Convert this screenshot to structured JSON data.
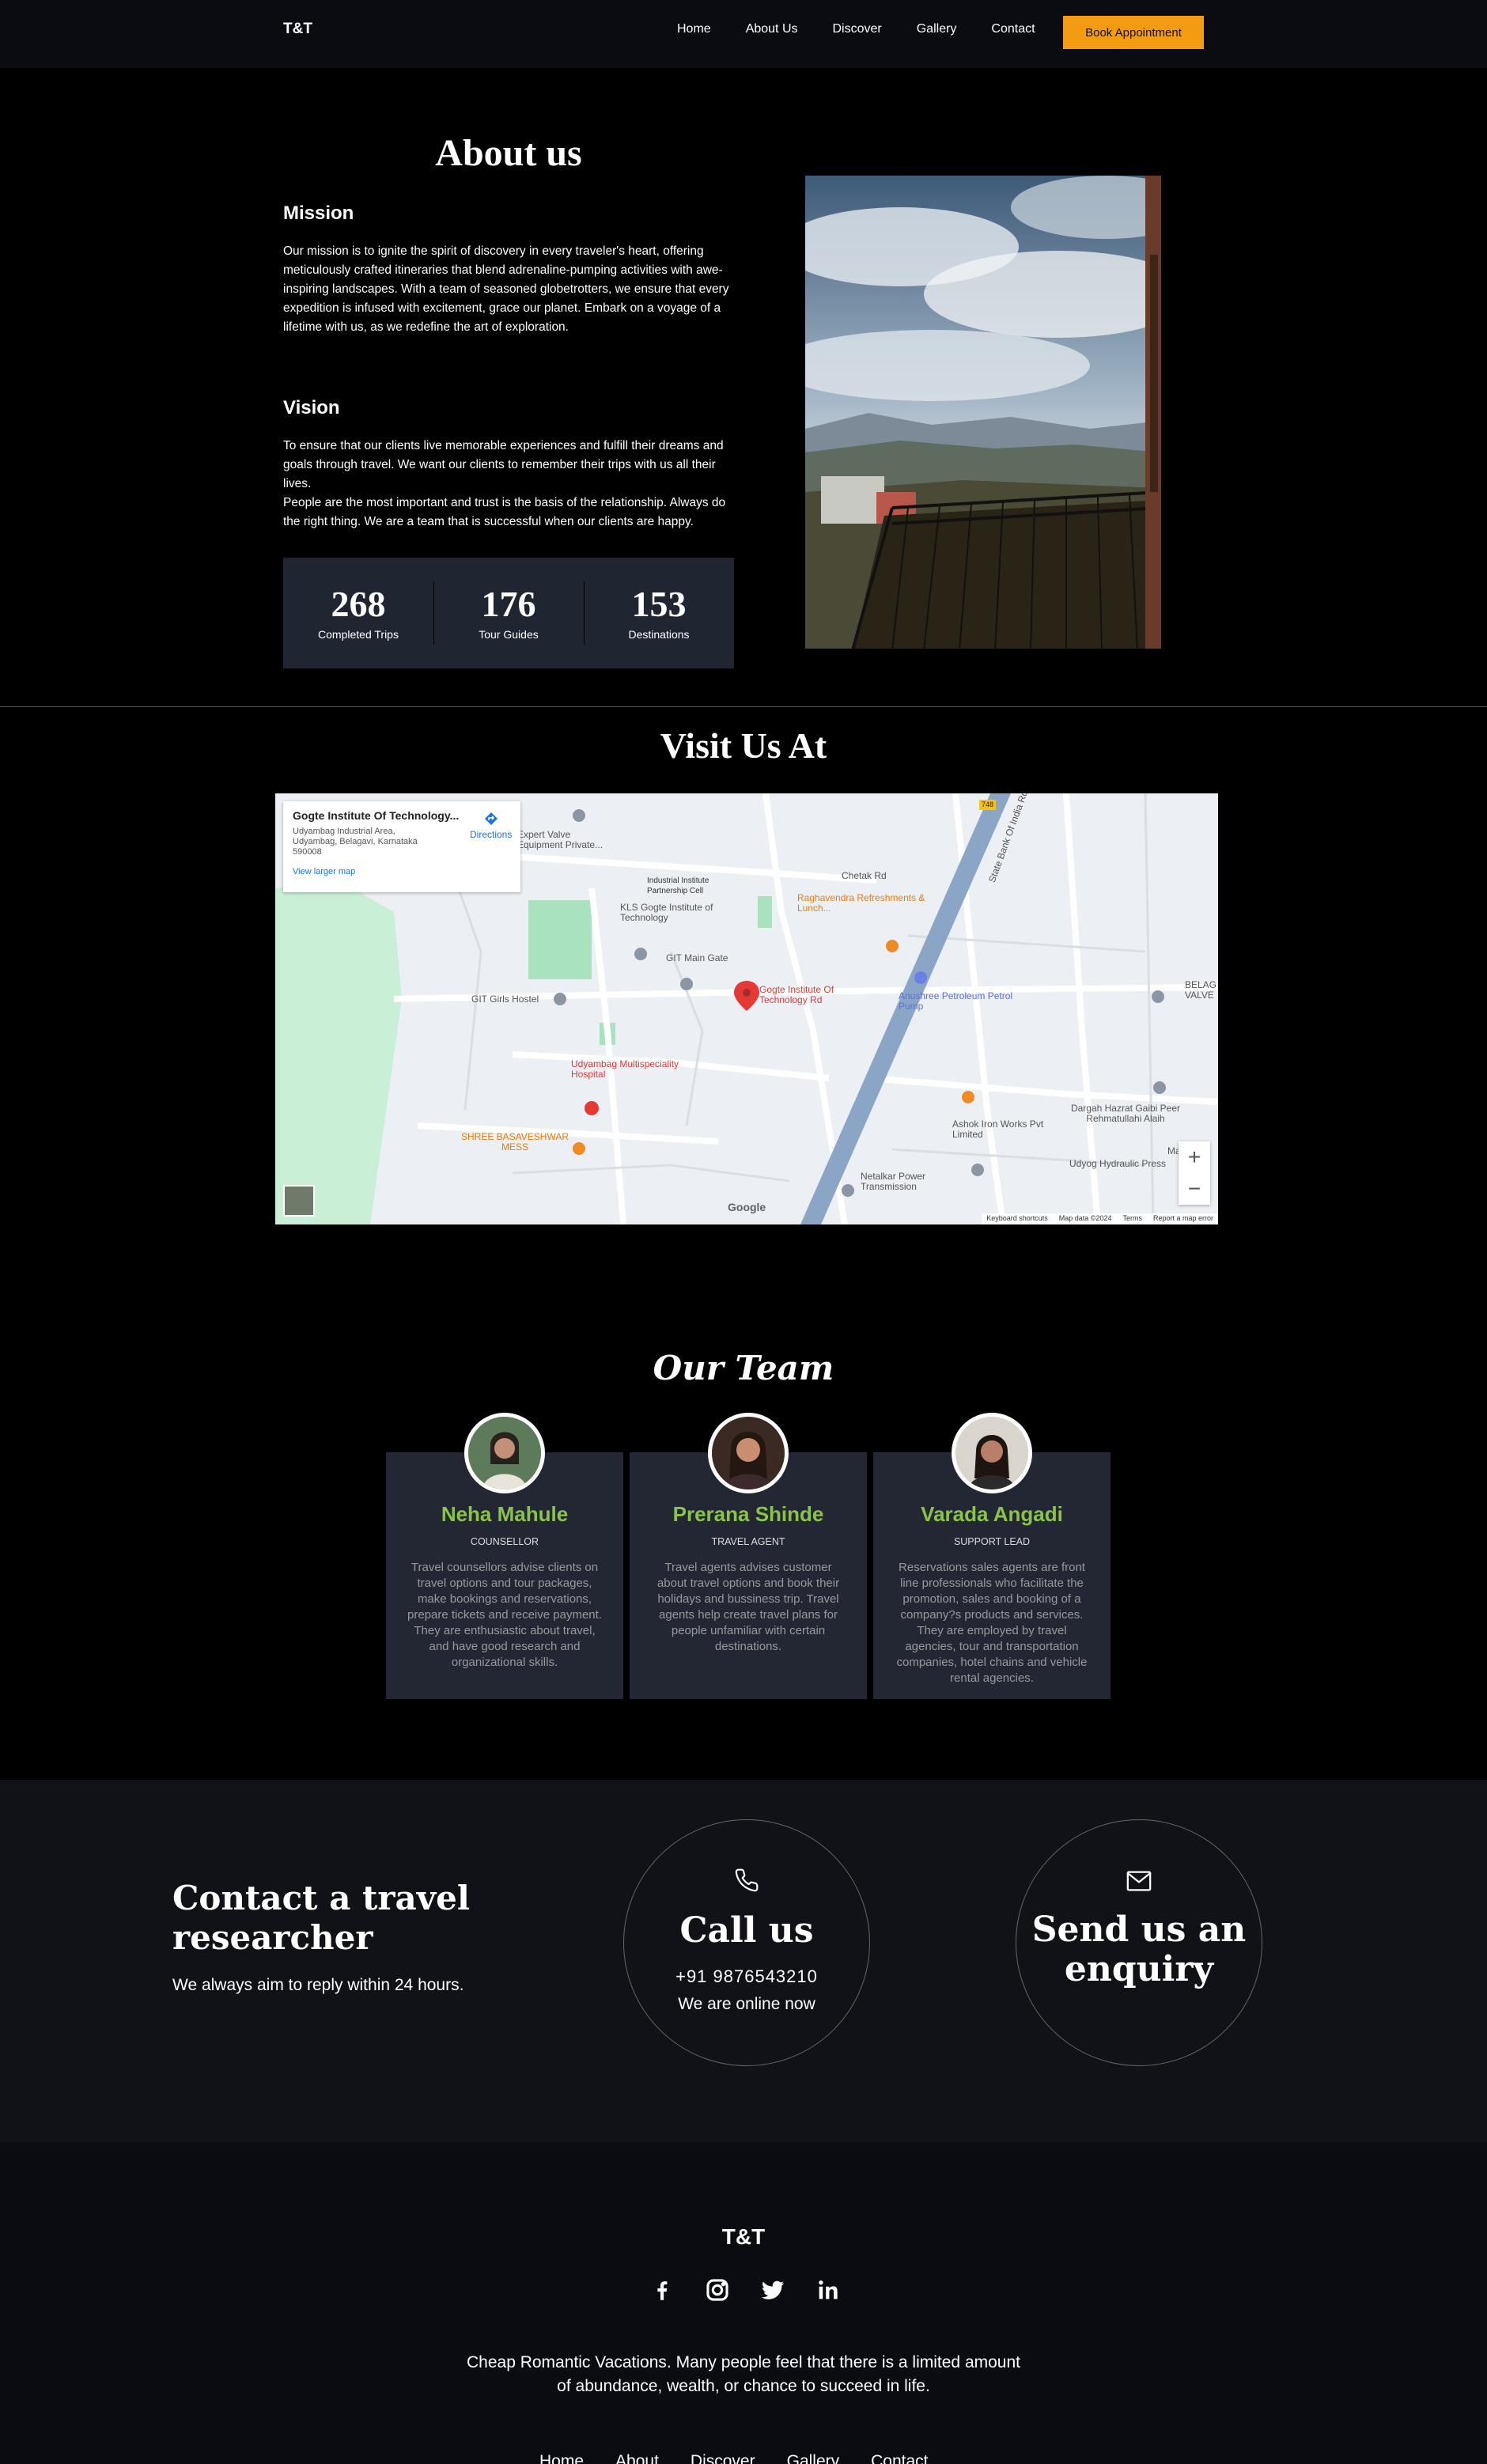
{
  "nav": {
    "brand": "T&T",
    "links": [
      "Home",
      "About Us",
      "Discover",
      "Gallery",
      "Contact"
    ],
    "cta": "Book Appointment",
    "accent": "#f39c12"
  },
  "about": {
    "title": "About us",
    "mission_heading": "Mission",
    "mission_text": "Our mission is to ignite the spirit of discovery in every traveler's heart, offering meticulously crafted itineraries that blend adrenaline-pumping activities with awe-inspiring landscapes. With a team of seasoned globetrotters, we ensure that every expedition is infused with excitement, grace our planet. Embark on a voyage of a lifetime with us, as we redefine the art of exploration.",
    "vision_heading": "Vision",
    "vision_text_1": "To ensure that our clients live memorable experiences and fulfill their dreams and goals through travel. We want our clients to remember their trips with us all their lives.",
    "vision_text_2": "People are the most important and trust is the basis of the relationship. Always do the right thing. We are a team that is successful when our clients are happy.",
    "stats": [
      {
        "value": "268",
        "label": "Completed Trips"
      },
      {
        "value": "176",
        "label": "Tour Guides"
      },
      {
        "value": "153",
        "label": "Destinations"
      }
    ]
  },
  "visit": {
    "title": "Visit Us At",
    "map": {
      "place_name": "Gogte Institute Of Technology...",
      "address": "Udyambag Industrial Area, Udyambag, Belagavi, Karnataka 590008",
      "directions": "Directions",
      "larger_map": "View larger map",
      "pin_label": "Gogte Institute Of Technology Rd",
      "labels": {
        "expert": "Expert Valve Equipment Private...",
        "industrial": "Industrial Institute Partnership Cell",
        "kls": "KLS Gogte Institute of Technology",
        "chetak": "Chetak Rd",
        "raghavendra": "Raghavendra Refreshments & Lunch...",
        "gitgate": "GIT Main Gate",
        "girls": "GIT Girls Hostel",
        "anushree": "Anushree Petroleum Petrol Pump",
        "hospital": "Udyambag Multispeciality Hospital",
        "shree": "SHREE BASAVESHWAR MESS",
        "dargah": "Dargah Hazrat Gaibi Peer Rehmatullahi Alaih",
        "ashok": "Ashok Iron Works Pvt Limited",
        "udyog": "Udyog Hydraulic Press",
        "netalkar": "Netalkar Power Transmission",
        "state": "State Bank Of India Rd",
        "belag": "BELAG VALVE",
        "maaruti": "Maaruti",
        "road_num": "748"
      },
      "google": "Google",
      "footer": [
        "Keyboard shortcuts",
        "Map data ©2024",
        "Terms",
        "Report a map error"
      ],
      "zoom_in": "+",
      "zoom_out": "−"
    }
  },
  "team": {
    "title": "Our Team",
    "members": [
      {
        "name": "Neha Mahule",
        "role": "COUNSELLOR",
        "desc": "Travel counsellors advise clients on travel options and tour packages, make bookings and reservations, prepare tickets and receive payment. They are enthusiastic about travel, and have good research and organizational skills."
      },
      {
        "name": "Prerana Shinde",
        "role": "TRAVEL AGENT",
        "desc": "Travel agents advises customer about travel options and book their holidays and bussiness trip. Travel agents help create travel plans for people unfamiliar with certain destinations."
      },
      {
        "name": "Varada Angadi",
        "role": "SUPPORT LEAD",
        "desc": "Reservations sales agents are front line professionals who facilitate the promotion, sales and booking of a company?s products and services. They are employed by travel agencies, tour and transportation companies, hotel chains and vehicle rental agencies."
      }
    ],
    "name_color": "#8bc34a"
  },
  "contact": {
    "heading": "Contact a travel researcher",
    "subtext": "We always aim to reply within 24 hours.",
    "call_title": "Call us",
    "phone": "+91  9876543210",
    "call_sub": "We are online now",
    "enquiry_title": "Send us an enquiry",
    "call_icon": "phone-icon",
    "mail_icon": "mail-icon"
  },
  "footer": {
    "brand": "T&T",
    "socials": [
      "facebook-icon",
      "instagram-icon",
      "twitter-icon",
      "linkedin-icon"
    ],
    "text": "Cheap Romantic Vacations. Many people feel that there is a limited amount of abundance, wealth, or chance to succeed in life.",
    "links": [
      "Home",
      "About",
      "Discover",
      "Gallery",
      "Contact"
    ]
  }
}
